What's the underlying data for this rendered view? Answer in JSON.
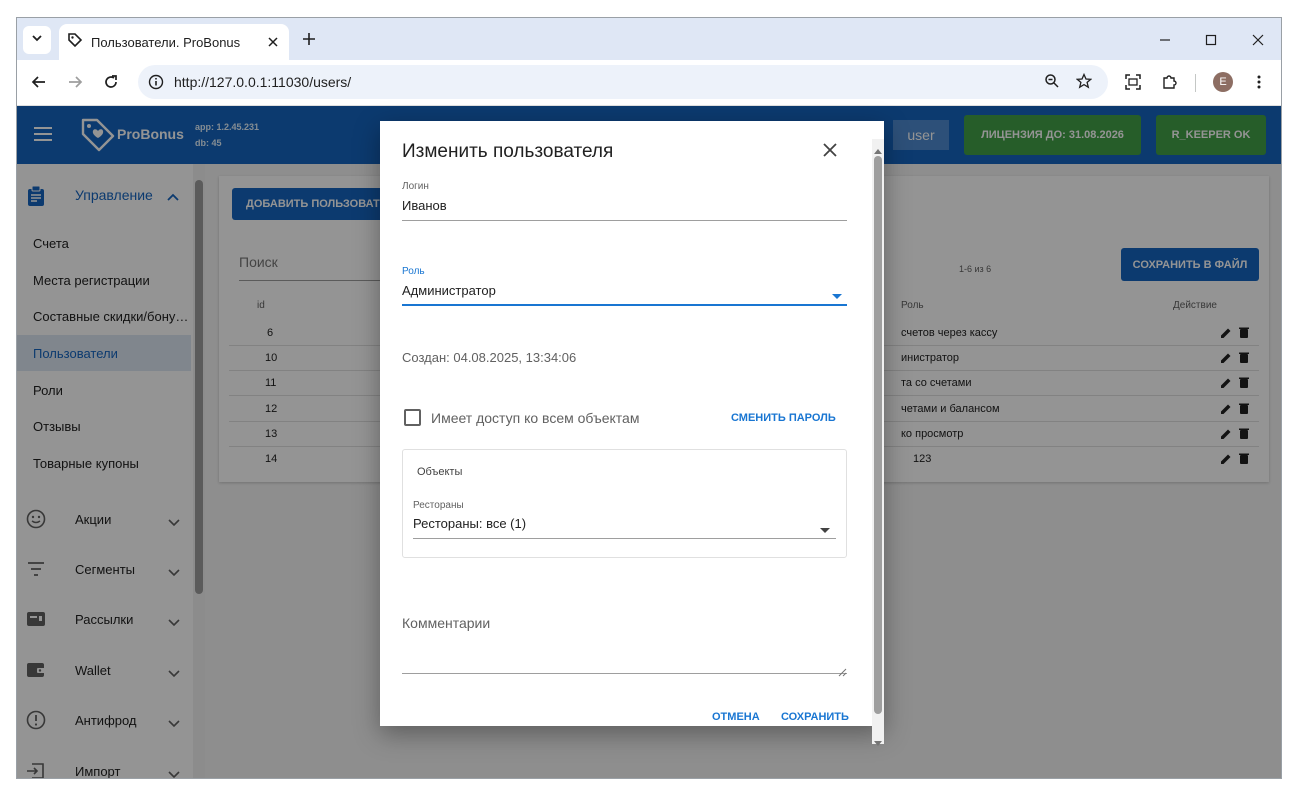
{
  "browser": {
    "tab_title": "Пользователи. ProBonus",
    "url": "http://127.0.0.1:11030/users/",
    "profile_initial": "E"
  },
  "app": {
    "logo_text": "ProBonus",
    "app_version": "app: 1.2.45.231",
    "db_version": "db: 45",
    "user_label": "user",
    "license_label": "ЛИЦЕНЗИЯ ДО: 31.08.2026",
    "rkeeper_label": "R_KEEPER OK"
  },
  "sidebar": {
    "section_title": "Управление",
    "items": [
      {
        "label": "Счета"
      },
      {
        "label": "Места регистрации"
      },
      {
        "label": "Составные скидки/бону…"
      },
      {
        "label": "Пользователи"
      },
      {
        "label": "Роли"
      },
      {
        "label": "Отзывы"
      },
      {
        "label": "Товарные купоны"
      }
    ],
    "groups": [
      {
        "label": "Акции",
        "icon": "smile-icon"
      },
      {
        "label": "Сегменты",
        "icon": "sort-icon"
      },
      {
        "label": "Рассылки",
        "icon": "mailbox-icon"
      },
      {
        "label": "Wallet",
        "icon": "wallet-icon"
      },
      {
        "label": "Антифрод",
        "icon": "alert-icon"
      },
      {
        "label": "Импорт",
        "icon": "import-icon"
      }
    ]
  },
  "main": {
    "add_user_label": "ДОБАВИТЬ ПОЛЬЗОВАТЕЛЯ",
    "search_placeholder": "Поиск",
    "pagination": "1-6 из 6",
    "save_file_label": "СОХРАНИТЬ В ФАЙЛ",
    "columns": {
      "id": "id",
      "role": "Роль",
      "action": "Действие"
    },
    "rows": [
      {
        "id": "6",
        "role": "счетов через кассу"
      },
      {
        "id": "10",
        "role": "инистратор"
      },
      {
        "id": "11",
        "role": "та со счетами"
      },
      {
        "id": "12",
        "role": "четами и балансом"
      },
      {
        "id": "13",
        "role": "ко просмотр"
      },
      {
        "id": "14",
        "role": "123"
      }
    ]
  },
  "dialog": {
    "title": "Изменить пользователя",
    "login_label": "Логин",
    "login_value": "Иванов",
    "role_label": "Роль",
    "role_value": "Администратор",
    "created": "Создан: 04.08.2025, 13:34:06",
    "access_all_label": "Имеет доступ ко всем объектам",
    "change_password_label": "СМЕНИТЬ ПАРОЛЬ",
    "objects_title": "Объекты",
    "restaurants_label": "Рестораны",
    "restaurants_value": "Рестораны: все (1)",
    "comments_label": "Комментарии",
    "cancel_label": "ОТМЕНА",
    "save_label": "СОХРАНИТЬ"
  }
}
